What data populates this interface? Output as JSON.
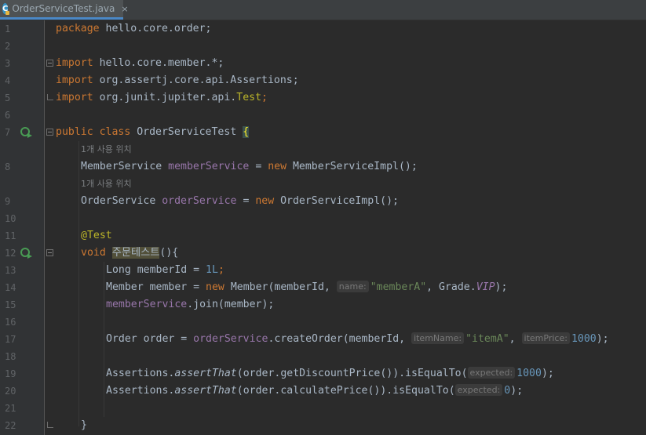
{
  "tab": {
    "icon_letter": "C",
    "title": "OrderServiceTest.java",
    "close": "×"
  },
  "colors": {
    "background": "#2b2b2b",
    "keyword": "#cc7832",
    "field": "#9876aa",
    "string": "#6a8759",
    "number": "#6897bb",
    "annotation": "#bbb529"
  },
  "icons": {
    "run": "run-test-icon",
    "fold": "fold-icon"
  },
  "line_numbers": [
    "1",
    "2",
    "3",
    "4",
    "5",
    "6",
    "7",
    "8",
    "9",
    "10",
    "11",
    "12",
    "13",
    "14",
    "15",
    "16",
    "17",
    "18",
    "19",
    "20",
    "21",
    "22"
  ],
  "code": {
    "l1": {
      "kw": "package",
      "rest": " hello.core.order;"
    },
    "l3": {
      "kw": "import",
      "rest": " hello.core.member.*;"
    },
    "l4": {
      "kw": "import",
      "rest": " org.assertj.core.api.Assertions;"
    },
    "l5": {
      "kw": "import",
      "rest": " org.junit.jupiter.api.",
      "ann": "Test",
      "end": ";"
    },
    "l7": {
      "kw": "public class",
      "rest": " OrderServiceTest ",
      "brace": "{"
    },
    "hint1": "1개 사용 위치",
    "l8": {
      "type": "MemberService ",
      "field": "memberService",
      "eq": " = ",
      "kw": "new",
      "rest": " MemberServiceImpl();"
    },
    "hint2": "1개 사용 위치",
    "l9": {
      "type": "OrderService ",
      "field": "orderService",
      "eq": " = ",
      "kw": "new",
      "rest": " OrderServiceImpl();"
    },
    "l11": {
      "ann": "@Test"
    },
    "l12": {
      "kw": "void",
      "name": "주문테스트",
      "rest": "(){"
    },
    "l13": {
      "a": "Long memberId = ",
      "num": "1L",
      "end": ";"
    },
    "l14": {
      "a": "Member member = ",
      "kw": "new",
      "b": " Member(memberId, ",
      "hint": "name:",
      "str": "\"memberA\"",
      "c": ", Grade.",
      "field": "VIP",
      "end": ");"
    },
    "l15": {
      "field": "memberService",
      "rest": ".join(member);"
    },
    "l17": {
      "a": "Order order = ",
      "field": "orderService",
      "b": ".createOrder(memberId, ",
      "hint1": "itemName:",
      "str": "\"itemA\"",
      "c": ", ",
      "hint2": "itemPrice:",
      "num": "1000",
      "end": ");"
    },
    "l19": {
      "a": "Assertions.",
      "method": "assertThat",
      "b": "(order.getDiscountPrice()).isEqualTo(",
      "hint": "expected:",
      "num": "1000",
      "end": ");"
    },
    "l20": {
      "a": "Assertions.",
      "method": "assertThat",
      "b": "(order.calculatePrice()).isEqualTo(",
      "hint": "expected:",
      "num": "0",
      "end": ");"
    },
    "l22": {
      "brace": "}"
    }
  }
}
